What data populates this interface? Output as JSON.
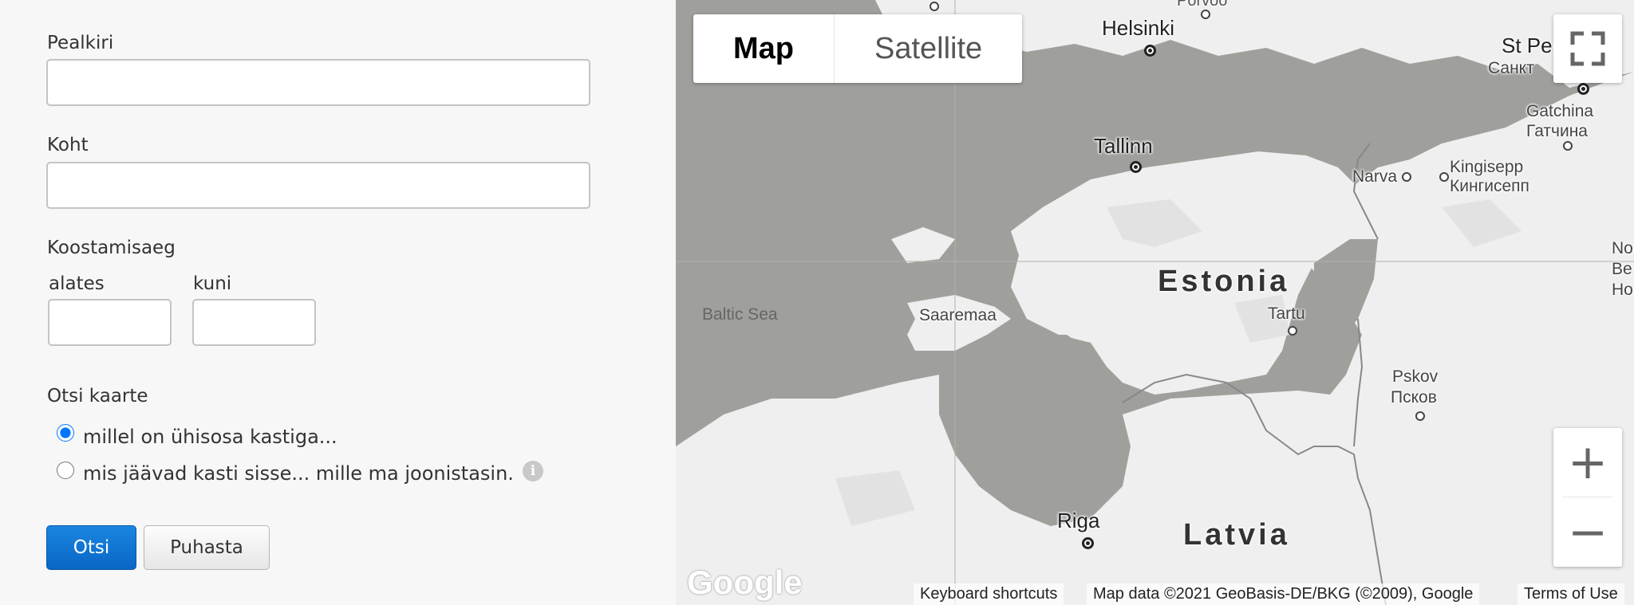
{
  "form": {
    "title_label": "Pealkiri",
    "title_value": "",
    "place_label": "Koht",
    "place_value": "",
    "date_label": "Koostamisaeg",
    "from_label": "alates",
    "from_value": "",
    "to_label": "kuni",
    "to_value": "",
    "search_mode_label": "Otsi kaarte",
    "options": [
      {
        "label": "millel on ühisosa kastiga...",
        "selected": true
      },
      {
        "label": "mis jäävad kasti sisse... mille ma joonistasin.",
        "selected": false
      }
    ],
    "info_icon": "info-icon",
    "search_button": "Otsi",
    "clear_button": "Puhasta"
  },
  "map": {
    "map_type_options": [
      "Map",
      "Satellite"
    ],
    "selected_map_type": "Map",
    "labels": {
      "porvoo": "Porvoo",
      "helsinki": "Helsinki",
      "st_petersburg": "St Pe",
      "st_petersburg_ru": "Санкт",
      "gatchina": "Gatchina",
      "gatchina_ru": "Гатчина",
      "tallinn": "Tallinn",
      "narva": "Narva",
      "kingisepp": "Kingisepp",
      "kingisepp_ru": "Кингисепп",
      "estonia": "Estonia",
      "baltic_sea": "Baltic Sea",
      "saaremaa": "Saaremaa",
      "tartu": "Tartu",
      "pskov": "Pskov",
      "pskov_ru": "Псков",
      "riga": "Riga",
      "latvia": "Latvia",
      "edge_no": "No",
      "edge_be": "Be",
      "edge_ho": "Ho"
    },
    "fullscreen_icon": "fullscreen-icon",
    "zoom_in_label": "+",
    "zoom_out_label": "−",
    "logo_text": "Google",
    "keyboard_shortcuts": "Keyboard shortcuts",
    "map_data": "Map data ©2021 GeoBasis-DE/BKG (©2009), Google",
    "terms": "Terms of Use"
  },
  "colors": {
    "water": "#9f9f9c",
    "land": "#efefef",
    "primary_button": "#0a66c6"
  }
}
